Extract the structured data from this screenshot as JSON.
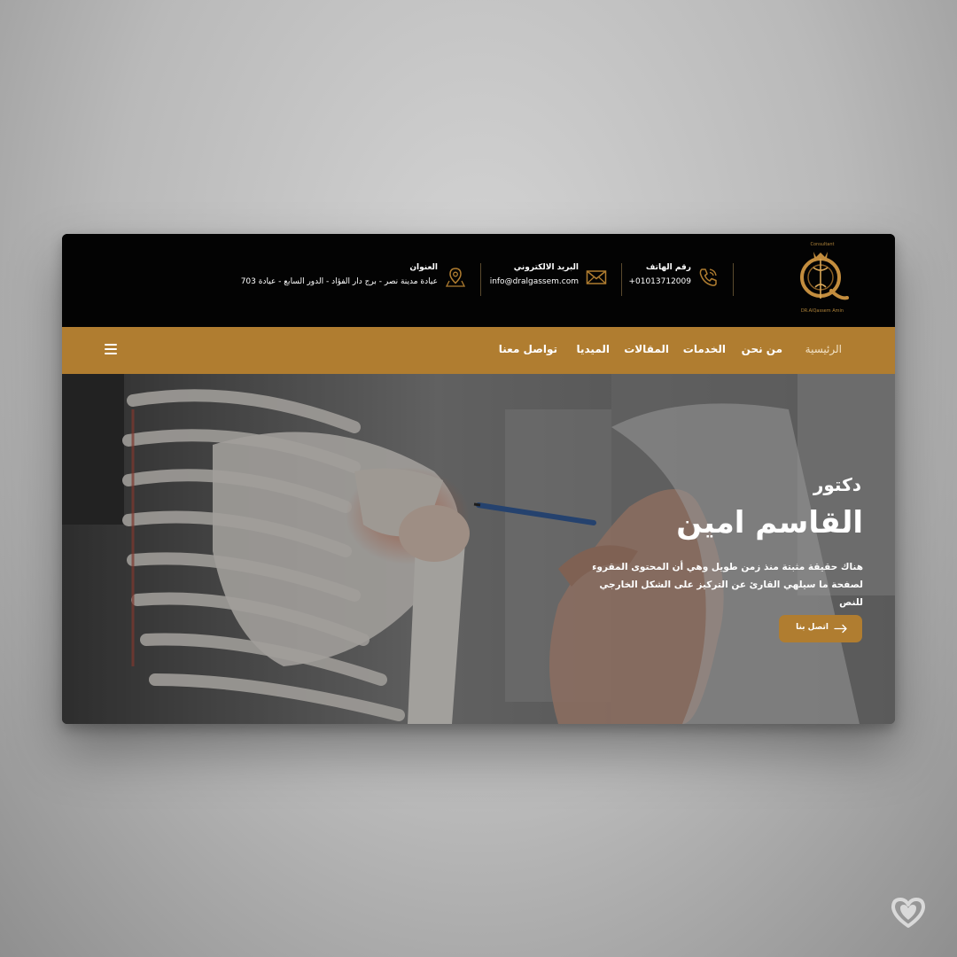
{
  "header": {
    "logo": {
      "caption_top": "Consultant",
      "caption_bottom": "DR.AlQassem Amin",
      "icon": "dr-alqassem-monogram-logo"
    },
    "phone": {
      "title": "رقم الهاتف",
      "value": "01013712009+",
      "icon": "phone-icon"
    },
    "email": {
      "title": "البريد الالكتروني",
      "value": "info@dralgassem.com",
      "icon": "envelope-icon"
    },
    "address": {
      "title": "العنوان",
      "value": "عيادة مدينة نصر - برج دار الفؤاد - الدور السابع - عيادة 703",
      "icon": "location-pin-icon"
    }
  },
  "nav": {
    "items": [
      {
        "label": "الرئيسية",
        "active": true
      },
      {
        "label": "من نحن"
      },
      {
        "label": "الخدمات"
      },
      {
        "label": "المقالات"
      },
      {
        "label": "الميديا"
      },
      {
        "label": "تواصل معنا"
      }
    ],
    "menu_icon": "hamburger-menu-icon"
  },
  "hero": {
    "kicker": "دكتور",
    "title": "القاسم امين",
    "description": "هناك حقيقة مثبتة منذ زمن طويل وهي أن المحتوى المقروء لصفحة ما سيلهي القارئ عن التركيز على الشكل الخارجي للنص",
    "cta_label": "اتصل بنا",
    "cta_icon": "arrow-right-icon",
    "background": "skeleton-model-photo"
  },
  "colors": {
    "accent": "#b07d30",
    "topbar": "#030303",
    "text": "#ffffff"
  },
  "watermark_icon": "heart-icon"
}
